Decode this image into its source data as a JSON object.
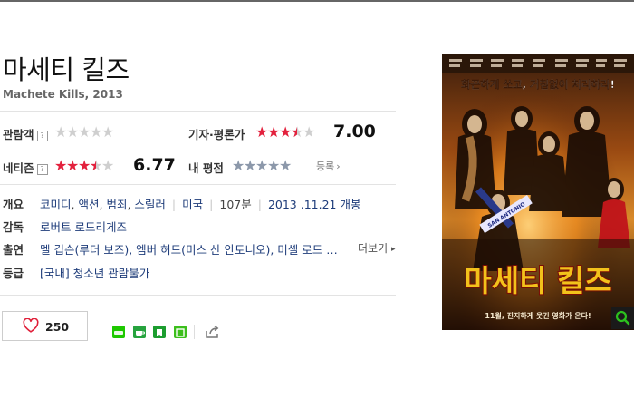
{
  "movie": {
    "title": "마세티 킬즈",
    "subtitle": "Machete Kills, 2013"
  },
  "ratings": {
    "audience": {
      "label": "관람객",
      "help": "?",
      "stars": 0
    },
    "critic": {
      "label": "기자·평론가",
      "score": "7.00",
      "stars": 3.5
    },
    "netizen": {
      "label": "네티즌",
      "help": "?",
      "score": "6.77",
      "stars": 3.5
    },
    "my_rating": {
      "label": "내 평점",
      "stars": 0,
      "register": "등록"
    }
  },
  "info": {
    "overview_label": "개요",
    "genres": [
      {
        "text": "코미디"
      },
      {
        "text": "액션"
      },
      {
        "text": "범죄"
      },
      {
        "text": "스릴러"
      }
    ],
    "genre_sep": ", ",
    "country": "미국",
    "runtime": "107분",
    "release": "2013 .11.21 개봉",
    "director_label": "감독",
    "director": "로버트 로드리게즈",
    "cast_label": "출연",
    "cast_text": "멜 깁슨(루더 보즈), 엠버 허드(미스 산 안토니오), 미셸 로드 …",
    "more": "더보기",
    "grade_label": "등급",
    "grade": "[국내] 청소년 관람불가"
  },
  "actions": {
    "like_count": "250"
  },
  "poster": {
    "tagline": "화끈하게 쏘고, 거침없이 처리하라!",
    "title": "마세티 킬즈",
    "release": "11월, 진지하게 웃긴 영화가 온다!",
    "sash": "SAN ANTONIO"
  },
  "icons": [
    "help-icon",
    "star-icon",
    "chevron-right-icon",
    "heart-icon",
    "share-icon",
    "zoom-icon"
  ],
  "colors": {
    "star_on": "#e3213d",
    "star_off": "#cfcfcf",
    "link": "#1e3c7a",
    "poster_title": "#f2c21b"
  }
}
